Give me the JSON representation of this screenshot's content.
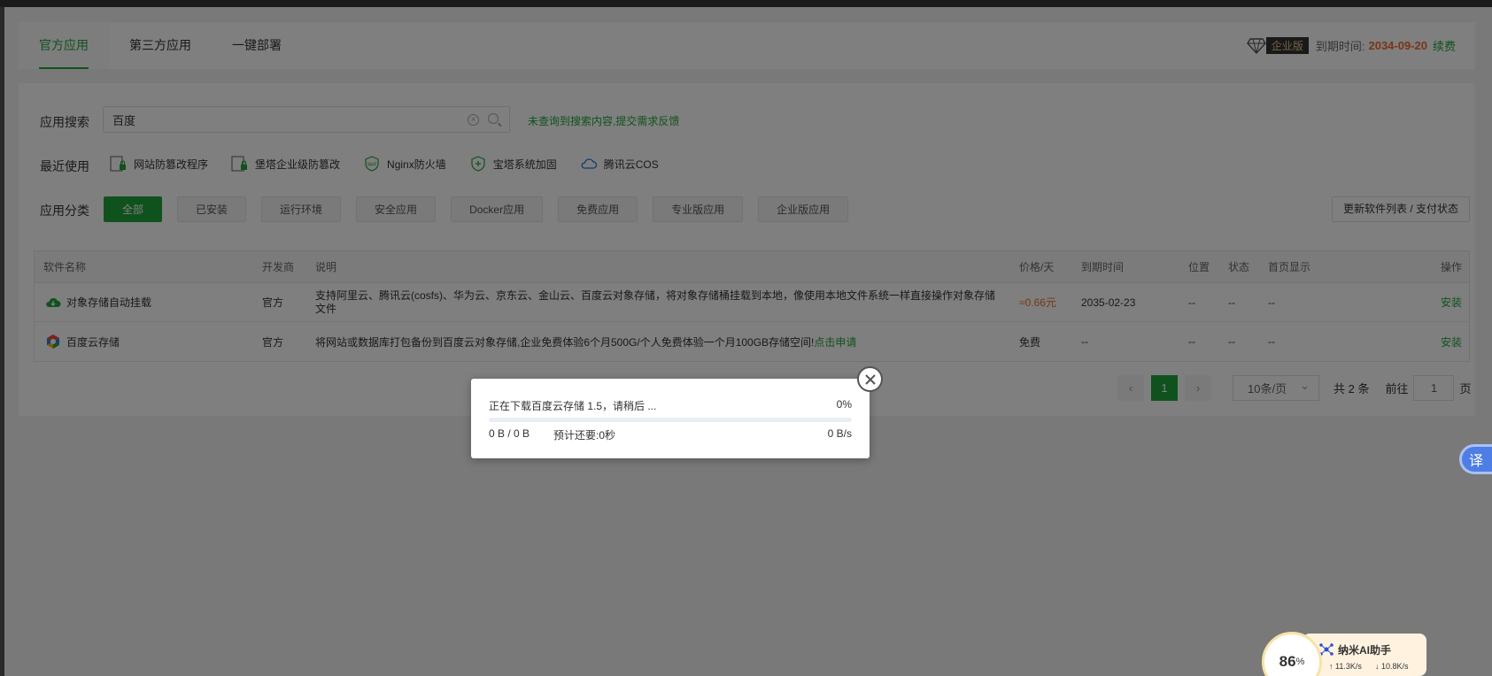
{
  "tabs": [
    {
      "label": "官方应用",
      "active": true
    },
    {
      "label": "第三方应用",
      "active": false
    },
    {
      "label": "一键部署",
      "active": false
    }
  ],
  "vip": {
    "badge": "企业版",
    "expiry_label": "到期时间:",
    "expiry_date": "2034-09-20",
    "renew": "续费"
  },
  "search": {
    "label": "应用搜索",
    "value": "百度",
    "clear_glyph": "×",
    "feedback": "未查询到搜索内容,提交需求反馈"
  },
  "recent": {
    "label": "最近使用",
    "items": [
      {
        "label": "网站防篡改程序",
        "icon": "lock-file-icon"
      },
      {
        "label": "堡塔企业级防篡改",
        "icon": "lock-file-icon"
      },
      {
        "label": "Nginx防火墙",
        "icon": "waf-shield-icon"
      },
      {
        "label": "宝塔系统加固",
        "icon": "shield-plus-icon"
      },
      {
        "label": "腾讯云COS",
        "icon": "cloud-icon"
      }
    ]
  },
  "categories": {
    "label": "应用分类",
    "items": [
      {
        "label": "全部",
        "active": true
      },
      {
        "label": "已安装",
        "active": false
      },
      {
        "label": "运行环境",
        "active": false
      },
      {
        "label": "安全应用",
        "active": false
      },
      {
        "label": "Docker应用",
        "active": false
      },
      {
        "label": "免费应用",
        "active": false
      },
      {
        "label": "专业版应用",
        "active": false
      },
      {
        "label": "企业版应用",
        "active": false
      }
    ],
    "refresh": "更新软件列表 / 支付状态"
  },
  "table": {
    "headers": {
      "name": "软件名称",
      "dev": "开发商",
      "desc": "说明",
      "price": "价格/天",
      "expire": "到期时间",
      "pos": "位置",
      "status": "状态",
      "home": "首页显示",
      "op": "操作"
    },
    "rows": [
      {
        "name": "对象存储自动挂载",
        "icon": "green-cloud-icon",
        "dev": "官方",
        "desc": "支持阿里云、腾讯云(cosfs)、华为云、京东云、金山云、百度云对象存储，将对象存储桶挂载到本地，像使用本地文件系统一样直接操作对象存储文件",
        "desc_link": "",
        "price": "≈0.66元",
        "expire": "2035-02-23",
        "pos": "--",
        "status": "--",
        "home": "--",
        "op": "安装"
      },
      {
        "name": "百度云存储",
        "icon": "baidu-cloud-icon",
        "dev": "官方",
        "desc": "将网站或数据库打包备份到百度云对象存储,企业免费体验6个月500G/个人免费体验一个月100GB存储空间!",
        "desc_link": "点击申请",
        "price": "免费",
        "expire": "--",
        "pos": "--",
        "status": "--",
        "home": "--",
        "op": "安装"
      }
    ]
  },
  "pager": {
    "prev": "‹",
    "current": "1",
    "next": "›",
    "size": "10条/页",
    "total": "共 2 条",
    "goto": "前往",
    "goto_value": "1",
    "page_suffix": "页"
  },
  "download_dialog": {
    "title": "正在下载百度云存储 1.5，请稍后 ...",
    "percent": "0%",
    "progress": 0,
    "bytes": "0 B / 0 B",
    "remaining": "预计还要:0秒",
    "speed": "0 B/s"
  },
  "translate": {
    "label": "译"
  },
  "ai": {
    "percent": "86",
    "percent_sign": "%",
    "name": "纳米AI助手",
    "upload": "↑ 11.3K/s",
    "download": "↓ 10.8K/s"
  },
  "colors": {
    "accent": "#20a53a",
    "orange": "#f06d2b"
  }
}
